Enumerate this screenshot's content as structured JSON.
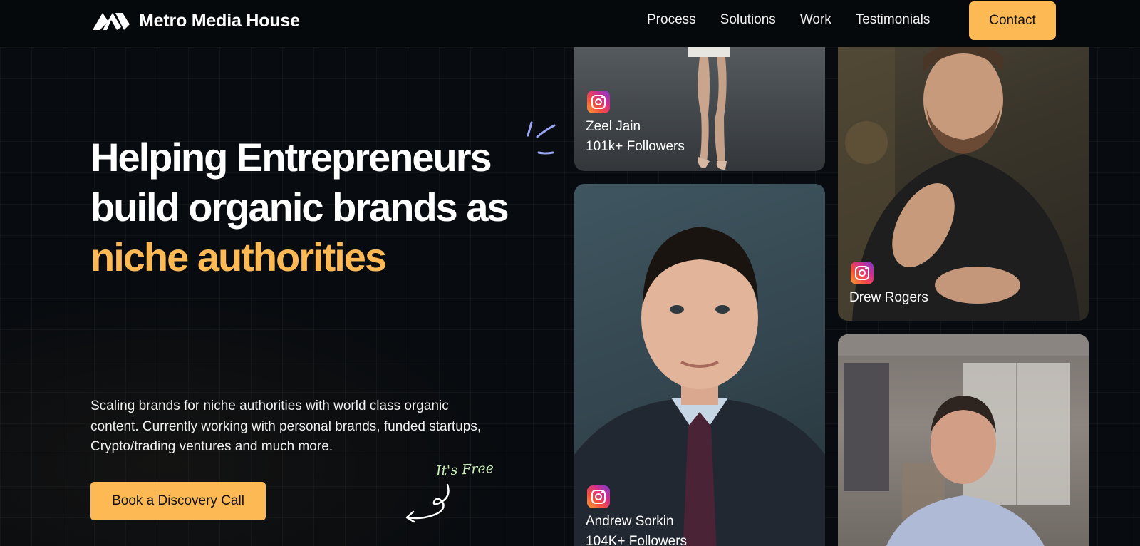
{
  "brand": {
    "name": "Metro Media House",
    "logo_icon": "logo-mark-icon"
  },
  "nav": {
    "links": [
      "Process",
      "Solutions",
      "Work",
      "Testimonials"
    ],
    "contact_label": "Contact"
  },
  "hero": {
    "headline_line1": "Helping Entrepreneurs",
    "headline_line2": "build organic brands as",
    "headline_accent": "niche authorities",
    "description": "Scaling brands for niche authorities with world class organic content. Currently working with personal brands, funded startups, Crypto/trading ventures and much more.",
    "cta_label": "Book a Discovery Call",
    "free_note": "It's Free"
  },
  "cards": [
    {
      "name": "Zeel Jain",
      "followers": "101k+ Followers",
      "icon": "instagram-icon"
    },
    {
      "name": "Drew Rogers",
      "followers": "",
      "icon": "instagram-icon"
    },
    {
      "name": "Andrew Sorkin",
      "followers": "104K+ Followers",
      "icon": "instagram-icon"
    },
    {
      "name": "",
      "followers": "",
      "icon": ""
    }
  ],
  "colors": {
    "accent": "#fdb954",
    "background": "#080b0f",
    "note": "#c8efb8",
    "doodle": "#9aa6f5"
  }
}
